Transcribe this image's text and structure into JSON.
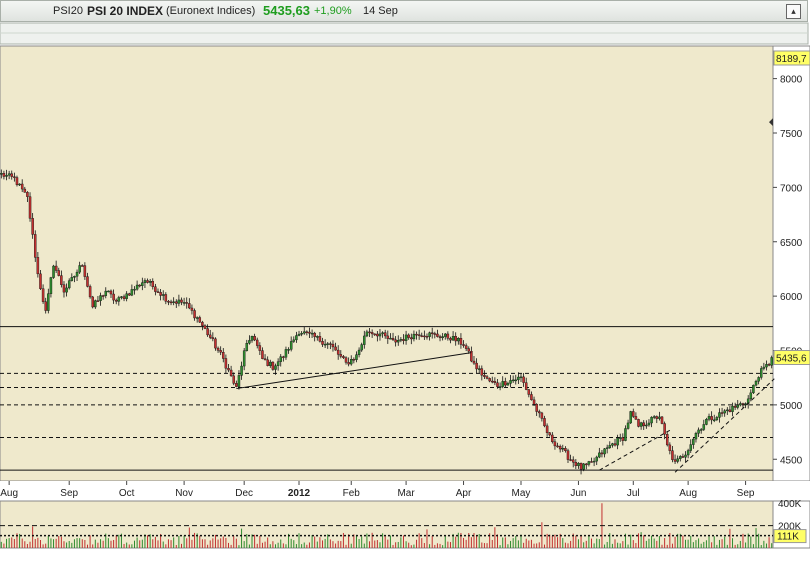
{
  "header": {
    "symbol": "PSI20",
    "name": "PSI 20 INDEX",
    "exchange": "(Euronext Indices)",
    "last": "5435,63",
    "change": "+1,90%",
    "date": "14 Sep",
    "collapse_label": "▴"
  },
  "colors": {
    "background": "#efe9cc",
    "up": "#2e8b2e",
    "down": "#c23030",
    "wick": "#111111"
  },
  "chart_data": {
    "type": "candlestick",
    "instrument": "PSI 20 INDEX",
    "ylim": [
      4300,
      8300
    ],
    "y_ticks": [
      "8000",
      "7500",
      "7000",
      "6500",
      "6000",
      "5500",
      "5000",
      "4500"
    ],
    "y_tick_values": [
      8000,
      7500,
      7000,
      6500,
      6000,
      5500,
      5000,
      4500
    ],
    "top_value_label": "8189,7",
    "top_value": 8189.7,
    "last_value_label": "5435,6",
    "last_value": 5435.6,
    "x_labels": [
      "Aug",
      "Sep",
      "Oct",
      "Nov",
      "Dec",
      "2012",
      "Feb",
      "Mar",
      "Apr",
      "May",
      "Jun",
      "Jul",
      "Aug",
      "Sep"
    ],
    "x_label_index": [
      3,
      26,
      48,
      70,
      93,
      114,
      134,
      155,
      177,
      199,
      221,
      242,
      263,
      285
    ],
    "n_bars": 296,
    "anchors": [
      [
        0,
        7120
      ],
      [
        5,
        7080
      ],
      [
        10,
        6900
      ],
      [
        14,
        6200
      ],
      [
        17,
        5850
      ],
      [
        20,
        6300
      ],
      [
        24,
        6050
      ],
      [
        27,
        6150
      ],
      [
        31,
        6300
      ],
      [
        35,
        5900
      ],
      [
        40,
        6050
      ],
      [
        44,
        5950
      ],
      [
        50,
        6050
      ],
      [
        55,
        6150
      ],
      [
        60,
        6050
      ],
      [
        64,
        5960
      ],
      [
        70,
        5940
      ],
      [
        75,
        5800
      ],
      [
        80,
        5620
      ],
      [
        85,
        5420
      ],
      [
        90,
        5150
      ],
      [
        93,
        5480
      ],
      [
        96,
        5650
      ],
      [
        100,
        5420
      ],
      [
        104,
        5350
      ],
      [
        108,
        5450
      ],
      [
        114,
        5680
      ],
      [
        120,
        5620
      ],
      [
        126,
        5550
      ],
      [
        132,
        5380
      ],
      [
        136,
        5450
      ],
      [
        140,
        5680
      ],
      [
        145,
        5650
      ],
      [
        150,
        5580
      ],
      [
        155,
        5620
      ],
      [
        160,
        5660
      ],
      [
        166,
        5640
      ],
      [
        172,
        5620
      ],
      [
        177,
        5560
      ],
      [
        181,
        5370
      ],
      [
        186,
        5230
      ],
      [
        190,
        5180
      ],
      [
        194,
        5220
      ],
      [
        199,
        5250
      ],
      [
        202,
        5100
      ],
      [
        206,
        4900
      ],
      [
        210,
        4700
      ],
      [
        214,
        4600
      ],
      [
        218,
        4500
      ],
      [
        222,
        4420
      ],
      [
        226,
        4460
      ],
      [
        230,
        4560
      ],
      [
        234,
        4640
      ],
      [
        238,
        4700
      ],
      [
        241,
        4920
      ],
      [
        244,
        4800
      ],
      [
        248,
        4850
      ],
      [
        252,
        4900
      ],
      [
        255,
        4620
      ],
      [
        258,
        4460
      ],
      [
        262,
        4560
      ],
      [
        266,
        4740
      ],
      [
        270,
        4860
      ],
      [
        274,
        4900
      ],
      [
        278,
        4950
      ],
      [
        282,
        4990
      ],
      [
        286,
        5050
      ],
      [
        290,
        5280
      ],
      [
        294,
        5380
      ],
      [
        295,
        5435
      ]
    ],
    "horizontal_levels": [
      {
        "value": 5720,
        "style": "solid"
      },
      {
        "value": 5290,
        "style": "dashed"
      },
      {
        "value": 5160,
        "style": "dashed"
      },
      {
        "value": 5000,
        "style": "dashed"
      },
      {
        "value": 4700,
        "style": "dashed"
      },
      {
        "value": 4400,
        "style": "solid"
      }
    ],
    "trendlines": [
      {
        "x1": 90,
        "y1": 5150,
        "x2": 180,
        "y2": 5480,
        "style": "solid"
      },
      {
        "x1": 229,
        "y1": 4400,
        "x2": 257,
        "y2": 4780,
        "style": "dashed"
      },
      {
        "x1": 258,
        "y1": 4380,
        "x2": 296,
        "y2": 5240,
        "style": "dashed"
      }
    ],
    "volume": {
      "ylim": [
        0,
        420
      ],
      "tick_labels": [
        "400K",
        "200K"
      ],
      "tick_values": [
        400,
        200
      ],
      "average_label": "111K",
      "average_value": 111,
      "levels": [
        {
          "value": 200,
          "style": "dashed"
        },
        {
          "value": 111,
          "style": "dotted"
        }
      ],
      "spikes": [
        [
          207,
          230
        ],
        [
          230,
          400
        ]
      ]
    }
  }
}
